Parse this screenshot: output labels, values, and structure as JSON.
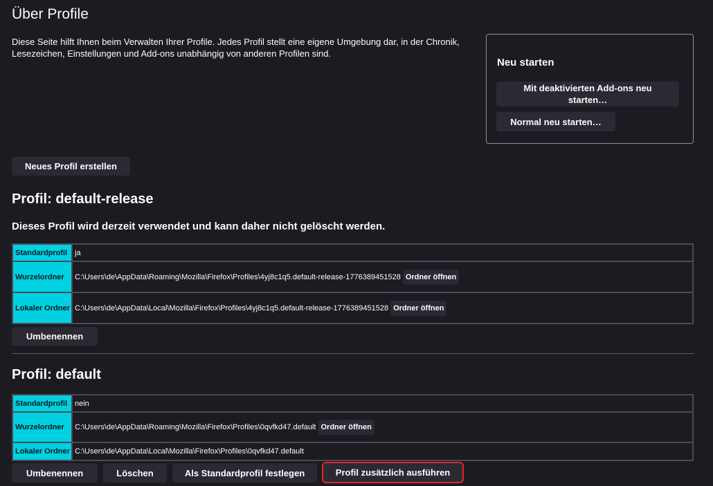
{
  "page": {
    "title": "Über Profile",
    "intro": "Diese Seite hilft Ihnen beim Verwalten Ihrer Profile. Jedes Profil stellt eine eigene Umgebung dar, in der Chronik, Lesezeichen, Einstellungen und Add-ons unabhängig von anderen Profilen sind.",
    "create_button": "Neues Profil erstellen"
  },
  "restart": {
    "title": "Neu starten",
    "safe_mode_button": "Mit deaktivierten Add-ons neu starten…",
    "normal_button": "Normal neu starten…"
  },
  "labels": {
    "default_profile": "Standardprofil",
    "root_folder": "Wurzelordner",
    "local_folder": "Lokaler Ordner",
    "open_folder": "Ordner öffnen",
    "rename": "Umbenennen",
    "delete": "Löschen",
    "set_default": "Als Standardprofil festlegen",
    "launch": "Profil zusätzlich ausführen"
  },
  "profiles": [
    {
      "heading": "Profil: default-release",
      "notice": "Dieses Profil wird derzeit verwendet und kann daher nicht gelöscht werden.",
      "is_default": "ja",
      "root_dir": "C:\\Users\\de\\AppData\\Roaming\\Mozilla\\Firefox\\Profiles\\4yj8c1q5.default-release-1776389451528",
      "local_dir": "C:\\Users\\de\\AppData\\Local\\Mozilla\\Firefox\\Profiles\\4yj8c1q5.default-release-1776389451528"
    },
    {
      "heading": "Profil: default",
      "is_default": "nein",
      "root_dir": "C:\\Users\\de\\AppData\\Roaming\\Mozilla\\Firefox\\Profiles\\0qvfkd47.default",
      "local_dir": "C:\\Users\\de\\AppData\\Local\\Mozilla\\Firefox\\Profiles\\0qvfkd47.default"
    }
  ],
  "colors": {
    "background": "#1c1b22",
    "button": "#2b2a33",
    "label_cell": "#00d0e0",
    "highlight": "#e0262a"
  }
}
